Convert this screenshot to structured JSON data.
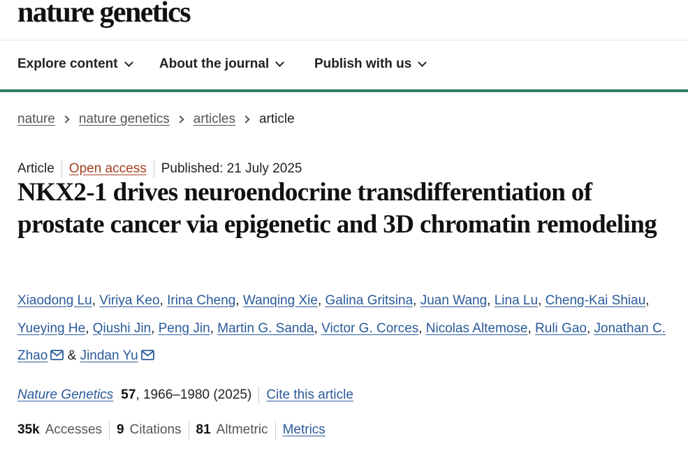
{
  "header": {
    "logo": "nature genetics"
  },
  "nav": {
    "items": [
      {
        "label": "Explore content"
      },
      {
        "label": "About the journal"
      },
      {
        "label": "Publish with us"
      }
    ]
  },
  "breadcrumb": {
    "items": [
      "nature",
      "nature genetics",
      "articles"
    ],
    "current": "article"
  },
  "article": {
    "type": "Article",
    "access": "Open access",
    "published": "Published: 21 July 2025",
    "title": "NKX2-1 drives neuroendocrine transdifferentiation of prostate cancer via epigenetic and 3D chromatin remodeling",
    "authors": [
      "Xiaodong Lu",
      "Viriya Keo",
      "Irina Cheng",
      "Wanqing Xie",
      "Galina Gritsina",
      "Juan Wang",
      "Lina Lu",
      "Cheng-Kai Shiau",
      "Yueying He",
      "Qiushi Jin",
      "Peng Jin",
      "Martin G. Sanda",
      "Victor G. Corces",
      "Nicolas Altemose",
      "Ruli Gao",
      "Jonathan C. Zhao",
      "Jindan Yu"
    ],
    "author_separator": ",",
    "author_conjunction": "&",
    "icons": {
      "corresponding": "mail-icon"
    }
  },
  "citation": {
    "journal": "Nature Genetics",
    "volume": "57",
    "pages_year": ", 1966–1980 (2025)",
    "cite_label": "Cite this article"
  },
  "metrics": {
    "accesses_value": "35k",
    "accesses_label": "Accesses",
    "citations_value": "9",
    "citations_label": "Citations",
    "altmetric_value": "81",
    "altmetric_label": "Altmetric",
    "metrics_link": "Metrics"
  },
  "colors": {
    "accent_green": "#2f8263",
    "link_blue": "#2a5a9a",
    "open_access": "#a33f1f"
  }
}
